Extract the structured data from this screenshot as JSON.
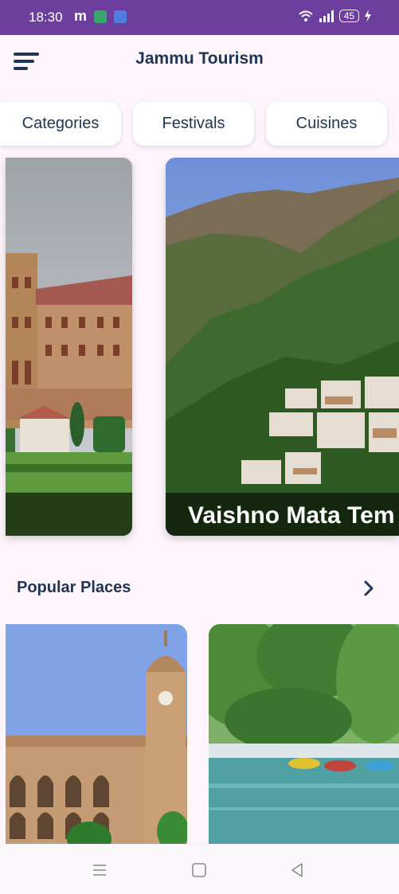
{
  "status_bar": {
    "time": "18:30",
    "m_label": "m",
    "battery": "45"
  },
  "header": {
    "title": "Jammu Tourism"
  },
  "chips": [
    {
      "label": "Categories"
    },
    {
      "label": "Festivals"
    },
    {
      "label": "Cuisines"
    }
  ],
  "carousel": {
    "right_caption": "Vaishno Mata Tem"
  },
  "popular": {
    "title": "Popular Places"
  },
  "colors": {
    "status_bar": "#6c3f9e",
    "text_dark": "#1f3554",
    "background": "#fdf5fb"
  }
}
